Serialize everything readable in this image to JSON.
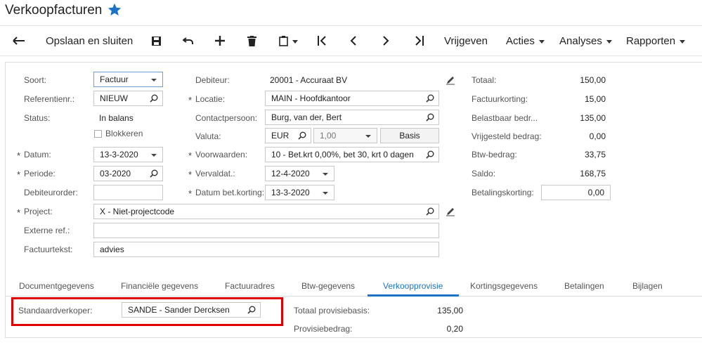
{
  "page": {
    "title": "Verkoopfacturen"
  },
  "toolbar": {
    "save_close": "Opslaan en sluiten",
    "release": "Vrijgeven",
    "actions": "Acties",
    "analyses": "Analyses",
    "reports": "Rapporten"
  },
  "left": {
    "type_label": "Soort:",
    "type_value": "Factuur",
    "ref_label": "Referentienr.:",
    "ref_value": "NIEUW",
    "status_label": "Status:",
    "status_value": "In balans",
    "block_label": "Blokkeren",
    "date_label": "Datum:",
    "date_value": "13-3-2020",
    "period_label": "Periode:",
    "period_value": "03-2020",
    "debtor_order_label": "Debiteurorder:",
    "debtor_order_value": "",
    "project_label": "Project:",
    "project_value": "X - Niet-projectcode",
    "ext_ref_label": "Externe ref.:",
    "ext_ref_value": "",
    "invoice_text_label": "Factuurtekst:",
    "invoice_text_value": "advies"
  },
  "middle": {
    "debtor_label": "Debiteur:",
    "debtor_value": "20001 - Accuraat BV",
    "location_label": "Locatie:",
    "location_value": "MAIN - Hoofdkantoor",
    "contact_label": "Contactpersoon:",
    "contact_value": "Burg, van der, Bert",
    "currency_label": "Valuta:",
    "currency_value": "EUR",
    "rate_value": "1,00",
    "basis_label": "Basis",
    "terms_label": "Voorwaarden:",
    "terms_value": "10 - Bet.krt 0,00%, bet 30, krt 0 dagen",
    "due_label": "Vervaldat.:",
    "due_value": "12-4-2020",
    "disc_date_label": "Datum bet.korting:",
    "disc_date_value": "13-3-2020"
  },
  "totals": {
    "total_label": "Totaal:",
    "total_value": "150,00",
    "inv_disc_label": "Factuurkorting:",
    "inv_disc_value": "15,00",
    "taxable_label": "Belastbaar bedr...",
    "taxable_value": "135,00",
    "exempt_label": "Vrijgesteld bedrag:",
    "exempt_value": "0,00",
    "vat_label": "Btw-bedrag:",
    "vat_value": "33,75",
    "balance_label": "Saldo:",
    "balance_value": "168,75",
    "pay_disc_label": "Betalingskorting:",
    "pay_disc_value": "0,00"
  },
  "tabs": [
    "Documentgegevens",
    "Financiële gegevens",
    "Factuuradres",
    "Btw-gegevens",
    "Verkoopprovisie",
    "Kortingsgegevens",
    "Betalingen",
    "Bijlagen"
  ],
  "commission": {
    "salesperson_label": "Standaardverkoper:",
    "salesperson_value": "SANDE - Sander Dercksen",
    "base_label": "Totaal provisiebasis:",
    "base_value": "135,00",
    "amount_label": "Provisiebedrag:",
    "amount_value": "0,20"
  },
  "colors": {
    "accent": "#1a73c8",
    "highlight": "#e00000"
  }
}
